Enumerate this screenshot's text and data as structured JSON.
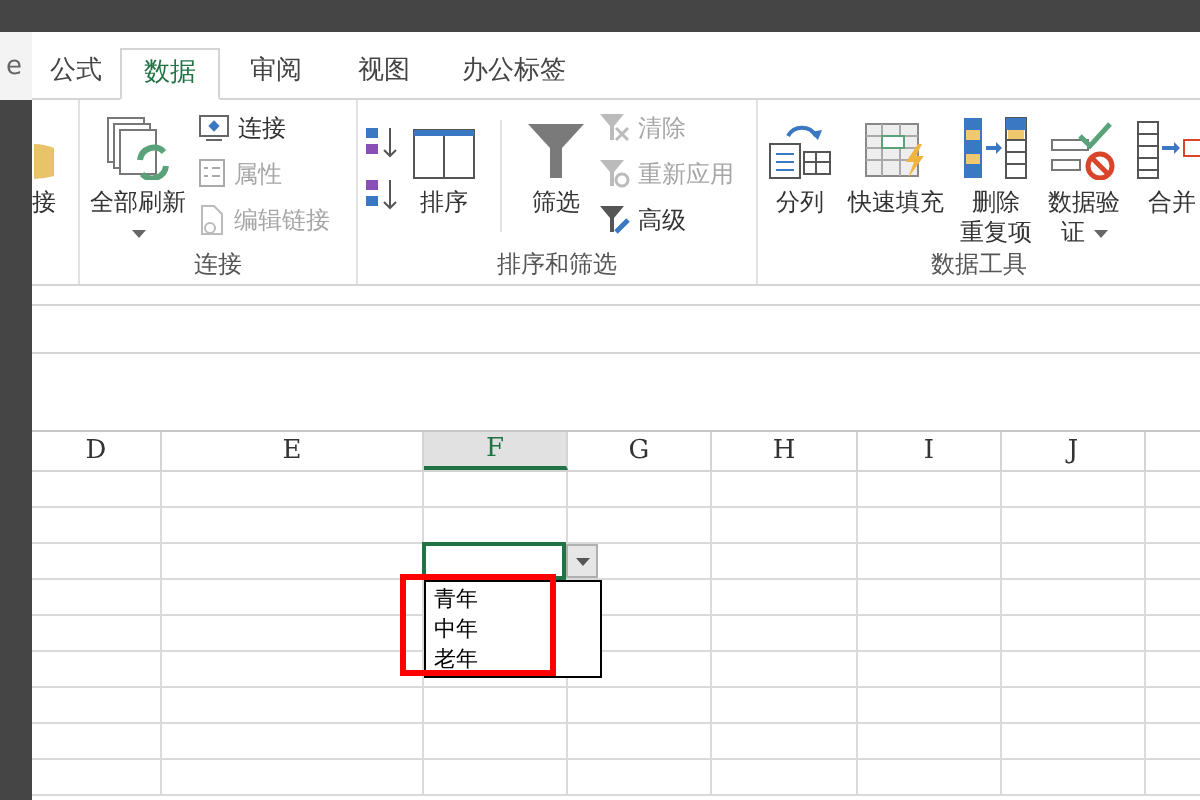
{
  "side_text": "e",
  "tabs": [
    {
      "label": "公式",
      "selected": false
    },
    {
      "label": "数据",
      "selected": true
    },
    {
      "label": "审阅",
      "selected": false
    },
    {
      "label": "视图",
      "selected": false
    },
    {
      "label": "办公标签",
      "selected": false
    }
  ],
  "ribbon_groups": [
    {
      "items": [
        {
          "kind": "large",
          "label": "接"
        }
      ]
    },
    {
      "label": "连接",
      "items": [
        {
          "kind": "large",
          "label": "全部刷新",
          "dropdown": true
        },
        {
          "kind": "stack",
          "rows": [
            {
              "label": "连接",
              "disabled": false
            },
            {
              "label": "属性",
              "disabled": true
            },
            {
              "label": "编辑链接",
              "disabled": true
            }
          ]
        }
      ]
    },
    {
      "label": "排序和筛选",
      "items": [
        {
          "kind": "icons"
        },
        {
          "kind": "large",
          "label": "排序"
        },
        {
          "kind": "separator"
        },
        {
          "kind": "large",
          "label": "筛选"
        },
        {
          "kind": "stack",
          "rows": [
            {
              "label": "清除",
              "disabled": true
            },
            {
              "label": "重新应用",
              "disabled": true
            },
            {
              "label": "高级",
              "disabled": false
            }
          ]
        }
      ]
    },
    {
      "label": "数据工具",
      "items": [
        {
          "kind": "large",
          "label": "分列"
        },
        {
          "kind": "large",
          "label": "快速填充"
        },
        {
          "kind": "large",
          "label": "删除",
          "label_2": "重复项"
        },
        {
          "kind": "large",
          "label": "数据验",
          "label_2": "证",
          "dropdown": true
        },
        {
          "kind": "large",
          "label": "合并"
        }
      ]
    }
  ],
  "columns": [
    {
      "label": "D",
      "selected": false
    },
    {
      "label": "E",
      "selected": false
    },
    {
      "label": "F",
      "selected": true
    },
    {
      "label": "G",
      "selected": false
    },
    {
      "label": "H",
      "selected": false
    },
    {
      "label": "I",
      "selected": false
    },
    {
      "label": "J",
      "selected": false
    }
  ],
  "dropdown_list": {
    "options": [
      "青年",
      "中年",
      "老年"
    ]
  }
}
